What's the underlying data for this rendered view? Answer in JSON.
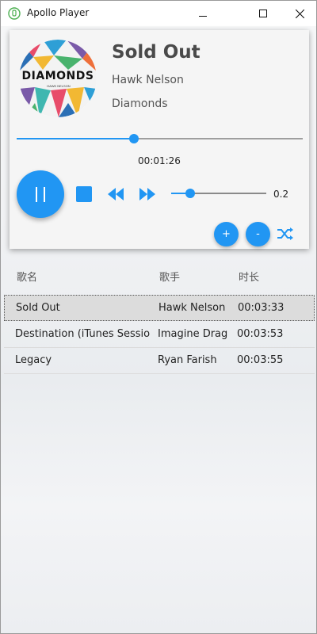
{
  "window": {
    "title": "Apollo Player",
    "minimize": "—",
    "maximize": "☐",
    "close": "✕"
  },
  "now_playing": {
    "title": "Sold Out",
    "artist": "Hawk Nelson",
    "album": "Diamonds",
    "cover_text": "DIAMONDS",
    "cover_subtext": "HAWK NELSON",
    "elapsed": "00:01:26",
    "progress_fraction": 0.41
  },
  "controls": {
    "play_icon": "pause-icon",
    "stop_icon": "stop-icon",
    "rewind_icon": "rewind-icon",
    "forward_icon": "fast-forward-icon",
    "volume_value": "0.2",
    "volume_fraction": 0.2,
    "add_label": "+",
    "remove_label": "-",
    "shuffle_icon": "shuffle-icon"
  },
  "playlist": {
    "headers": [
      "歌名",
      "歌手",
      "时长"
    ],
    "rows": [
      {
        "name": "Sold Out",
        "artist": "Hawk Nelson",
        "duration": "00:03:33",
        "selected": true
      },
      {
        "name": "Destination (iTunes Session)",
        "artist": "Imagine Dragons",
        "duration": "00:03:53",
        "selected": false
      },
      {
        "name": "Legacy",
        "artist": "Ryan Farish",
        "duration": "00:03:55",
        "selected": false
      }
    ]
  },
  "colors": {
    "accent": "#2196f3",
    "card_bg": "#f5f5f5",
    "selected_row": "#dcdcdc"
  }
}
